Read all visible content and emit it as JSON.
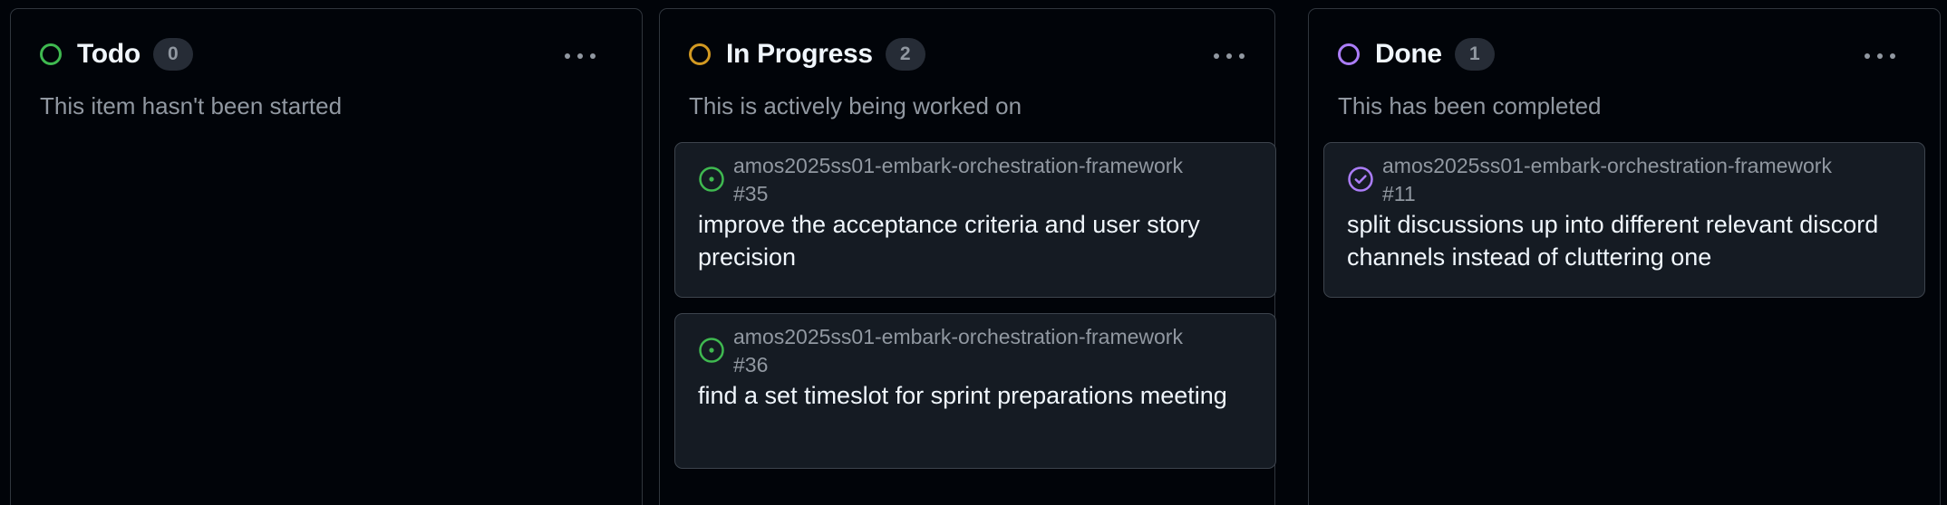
{
  "columns": [
    {
      "title": "Todo",
      "count": "0",
      "description": "This item hasn't been started",
      "color": "#3fb950",
      "cards": []
    },
    {
      "title": "In Progress",
      "count": "2",
      "description": "This is actively being worked on",
      "color": "#d29922",
      "cards": [
        {
          "repo": "amos2025ss01-embark-orchestration-framework #35",
          "title": "improve the acceptance criteria and user story precision",
          "icon": "issue-open-icon",
          "icon_color": "#3fb950"
        },
        {
          "repo": "amos2025ss01-embark-orchestration-framework #36",
          "title": "find a set timeslot for sprint preparations meeting",
          "icon": "issue-open-icon",
          "icon_color": "#3fb950"
        }
      ]
    },
    {
      "title": "Done",
      "count": "1",
      "description": "This has been completed",
      "color": "#ab7df8",
      "cards": [
        {
          "repo": "amos2025ss01-embark-orchestration-framework #11",
          "title": "split discussions up into different relevant discord channels instead of cluttering one",
          "icon": "issue-closed-icon",
          "icon_color": "#ab7df8"
        }
      ]
    }
  ],
  "icons": {
    "more": "kebab-horizontal-icon"
  }
}
